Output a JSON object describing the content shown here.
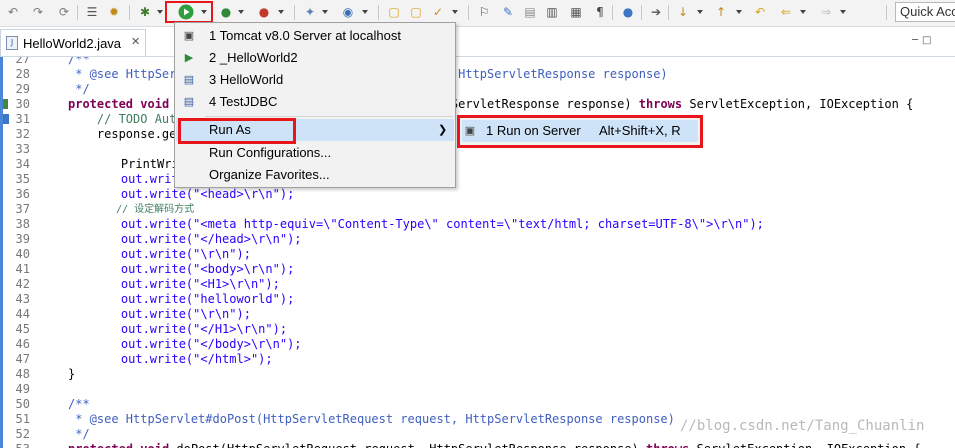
{
  "toolbar": {
    "quick_access_placeholder": "Quick Acc"
  },
  "editor_tab": {
    "title": "HelloWorld2.java",
    "close_glyph": "✕"
  },
  "run_menu": {
    "history": [
      {
        "label": "1 Tomcat v8.0 Server at localhost"
      },
      {
        "label": "2 _HelloWorld2"
      },
      {
        "label": "3 HelloWorld"
      },
      {
        "label": "4 TestJDBC"
      }
    ],
    "run_as": "Run As",
    "run_configurations": "Run Configurations...",
    "organize_favorites": "Organize Favorites...",
    "submenu": {
      "label": "1 Run on Server",
      "accelerator": "Alt+Shift+X, R"
    }
  },
  "code_lines": [
    {
      "n": "27",
      "text": "/**"
    },
    {
      "n": "28",
      "text": " * @see HttpServlet#doGet(HttpServletRequest request, HttpServletResponse response)"
    },
    {
      "n": "29",
      "text": " */"
    },
    {
      "n": "30",
      "text": "protected void doGet(HttpServletRequest request, HttpServletResponse response) throws ServletException, IOException {"
    },
    {
      "n": "31",
      "text": "    // TODO Auto-generated method stub"
    },
    {
      "n": "32",
      "text": "    response.getWriter();"
    },
    {
      "n": "33",
      "text": ""
    },
    {
      "n": "34",
      "text": "    PrintWriter out = response.getWriter();"
    },
    {
      "n": "35",
      "text": "    out.write(\"<html>\\r\\n\");"
    },
    {
      "n": "36",
      "text": "    out.write(\"<head>\\r\\n\");"
    },
    {
      "n": "37",
      "text": "    // 设定解码方式"
    },
    {
      "n": "38",
      "text": "    out.write(\"<meta http-equiv=\\\"Content-Type\\\" content=\\\"text/html; charset=UTF-8\\\">\\r\\n\");"
    },
    {
      "n": "39",
      "text": "    out.write(\"</head>\\r\\n\");"
    },
    {
      "n": "40",
      "text": "    out.write(\"\\r\\n\");"
    },
    {
      "n": "41",
      "text": "    out.write(\"<body>\\r\\n\");"
    },
    {
      "n": "42",
      "text": "    out.write(\"<H1>\\r\\n\");"
    },
    {
      "n": "43",
      "text": "    out.write(\"helloworld\");"
    },
    {
      "n": "44",
      "text": "    out.write(\"\\r\\n\");"
    },
    {
      "n": "45",
      "text": "    out.write(\"</H1>\\r\\n\");"
    },
    {
      "n": "46",
      "text": "    out.write(\"</body>\\r\\n\");"
    },
    {
      "n": "47",
      "text": "    out.write(\"</html>\");"
    },
    {
      "n": "48",
      "text": "}"
    },
    {
      "n": "49",
      "text": ""
    },
    {
      "n": "50",
      "text": "/**"
    },
    {
      "n": "51",
      "text": " * @see HttpServlet#doPost(HttpServletRequest request, HttpServletResponse response)"
    },
    {
      "n": "52",
      "text": " */"
    },
    {
      "n": "53",
      "text": "protected void doPost(HttpServletRequest request, HttpServletResponse response) throws ServletException, IOException {"
    }
  ],
  "watermark": "//blog.csdn.net/Tang_Chuanlin",
  "colors": {
    "highlight_box": "#e8161b",
    "menu_selection": "#cfe3f8",
    "keyword": "#7f0055",
    "string": "#2a00ff",
    "comment": "#3f7f5f",
    "javadoc": "#3f5fbf"
  }
}
